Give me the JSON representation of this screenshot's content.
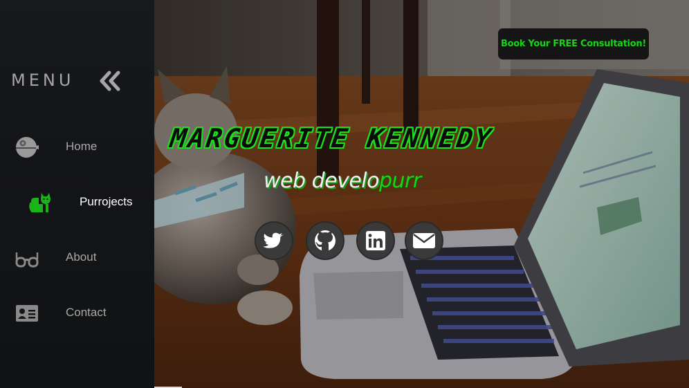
{
  "sidebar": {
    "menu_label": "MENU",
    "items": [
      {
        "label": "Home",
        "icon": "death-star-icon"
      },
      {
        "label": "Purrojects",
        "icon": "cat-icon",
        "active": true
      },
      {
        "label": "About",
        "icon": "glasses-icon"
      },
      {
        "label": "Contact",
        "icon": "id-card-icon"
      }
    ]
  },
  "hero": {
    "cta_label": "Book Your FREE Consultation!",
    "name": "MARGUERITE KENNEDY",
    "tagline_part1": "web develo",
    "tagline_part2": "purr",
    "social": [
      "twitter-icon",
      "github-icon",
      "linkedin-icon",
      "email-icon"
    ]
  },
  "colors": {
    "accent_green": "#17d417",
    "sidebar_bg": "#141518",
    "cta_bg": "#151515"
  }
}
